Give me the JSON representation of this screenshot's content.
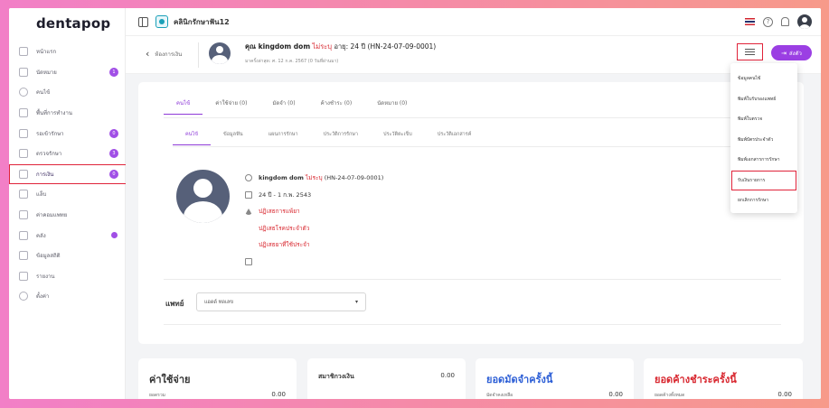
{
  "app": {
    "logo": "dentapop"
  },
  "sidebar": {
    "items": [
      {
        "label": "หน้าแรก",
        "badge": ""
      },
      {
        "label": "นัดหมาย",
        "badge": "1"
      },
      {
        "label": "คนไข้",
        "badge": ""
      },
      {
        "label": "พื้นที่การทำงาน",
        "badge": ""
      },
      {
        "label": "รอเข้ารักษา",
        "badge": "0"
      },
      {
        "label": "ตรวจรักษา",
        "badge": "3"
      },
      {
        "label": "การเงิน",
        "badge": "0"
      },
      {
        "label": "แล็บ",
        "badge": ""
      },
      {
        "label": "ค่าคอมแพทย",
        "badge": ""
      },
      {
        "label": "คลัง",
        "badge": ""
      },
      {
        "label": "ข้อมูลสถิติ",
        "badge": ""
      },
      {
        "label": "รายงาน",
        "badge": ""
      },
      {
        "label": "ตั้งค่า",
        "badge": ""
      }
    ]
  },
  "topbar": {
    "clinic_name": "คลินิกรักษาฟัน12",
    "help_glyph": "?"
  },
  "patient_header": {
    "back_label": "ห้องการเงิน",
    "name_prefix": "คุณ kingdom dom",
    "name_unspecified": "ไม่ระบุ",
    "name_suffix": "อายุ: 24 ปี (HN-24-07-09-0001)",
    "sub": "มาครั้งล่าสุด: ศ. 12 ก.ค. 2567 (0 วันที่ผ่านมา)",
    "send_label": "ส่งตัว"
  },
  "tabs_primary": [
    {
      "label": "คนไข้",
      "active": true
    },
    {
      "label": "ค่าใช้จ่าย (0)",
      "active": false
    },
    {
      "label": "มัดจำ (0)",
      "active": false
    },
    {
      "label": "ค้างชำระ (0)",
      "active": false
    },
    {
      "label": "นัดหมาย (0)",
      "active": false
    }
  ],
  "tabs_secondary": [
    {
      "label": "คนไข้",
      "active": true
    },
    {
      "label": "ข้อมูลฟัน",
      "active": false
    },
    {
      "label": "แผนการรักษา",
      "active": false
    },
    {
      "label": "ประวัติการรักษา",
      "active": false
    },
    {
      "label": "ประวัติตะเข็บ",
      "active": false
    },
    {
      "label": "ประวัติเอกสารค์",
      "active": false
    }
  ],
  "patient_info": {
    "name": "kingdom dom",
    "unspecified": "ไม่ระบุ",
    "hn": "(HN-24-07-09-0001)",
    "dob": "24 ปี - 1 ก.พ. 2543",
    "allergy": "ปฏิเสธการแพ้ยา",
    "disease": "ปฏิเสธโรคประจำตัว",
    "meds": "ปฏิเสธยาที่ใช้ประจำ"
  },
  "doctor": {
    "label": "แพทย์",
    "selected": "แอดด์ ทดเลข",
    "caret": "▾"
  },
  "summary_cards": [
    {
      "title": "ค่าใช้จ่าย",
      "value": "0.00",
      "sub": "ยอดรวม"
    },
    {
      "title": "สมาชิกวงเงิน",
      "value": "0.00"
    },
    {
      "title": "ยอดมัดจำครั้งนี้",
      "value": "0.00",
      "sub": "มัดจำคงเหลือ"
    },
    {
      "title": "ยอดค้างชำระครั้งนี้",
      "value": "0.00",
      "sub": "ยอดค้างทั้งหมด"
    }
  ],
  "dropdown": {
    "items": [
      {
        "label": "ข้อมูลคนไข้",
        "highlight": false
      },
      {
        "label": "พิมพ์ใบรับรองแพทย์",
        "highlight": false
      },
      {
        "label": "พิมพ์ใบตรวจ",
        "highlight": false
      },
      {
        "label": "พิมพ์บัตรประจำตัว",
        "highlight": false
      },
      {
        "label": "พิมพ์เอกสารการรักษา",
        "highlight": false
      },
      {
        "label": "รับเงินรายการ",
        "highlight": true
      },
      {
        "label": "ยกเลิกการรักษา",
        "highlight": false
      }
    ]
  },
  "colors": {
    "accent": "#9b3fe3",
    "highlight": "#e0233a",
    "blue": "#2d5fd6",
    "red": "#d8262e"
  }
}
